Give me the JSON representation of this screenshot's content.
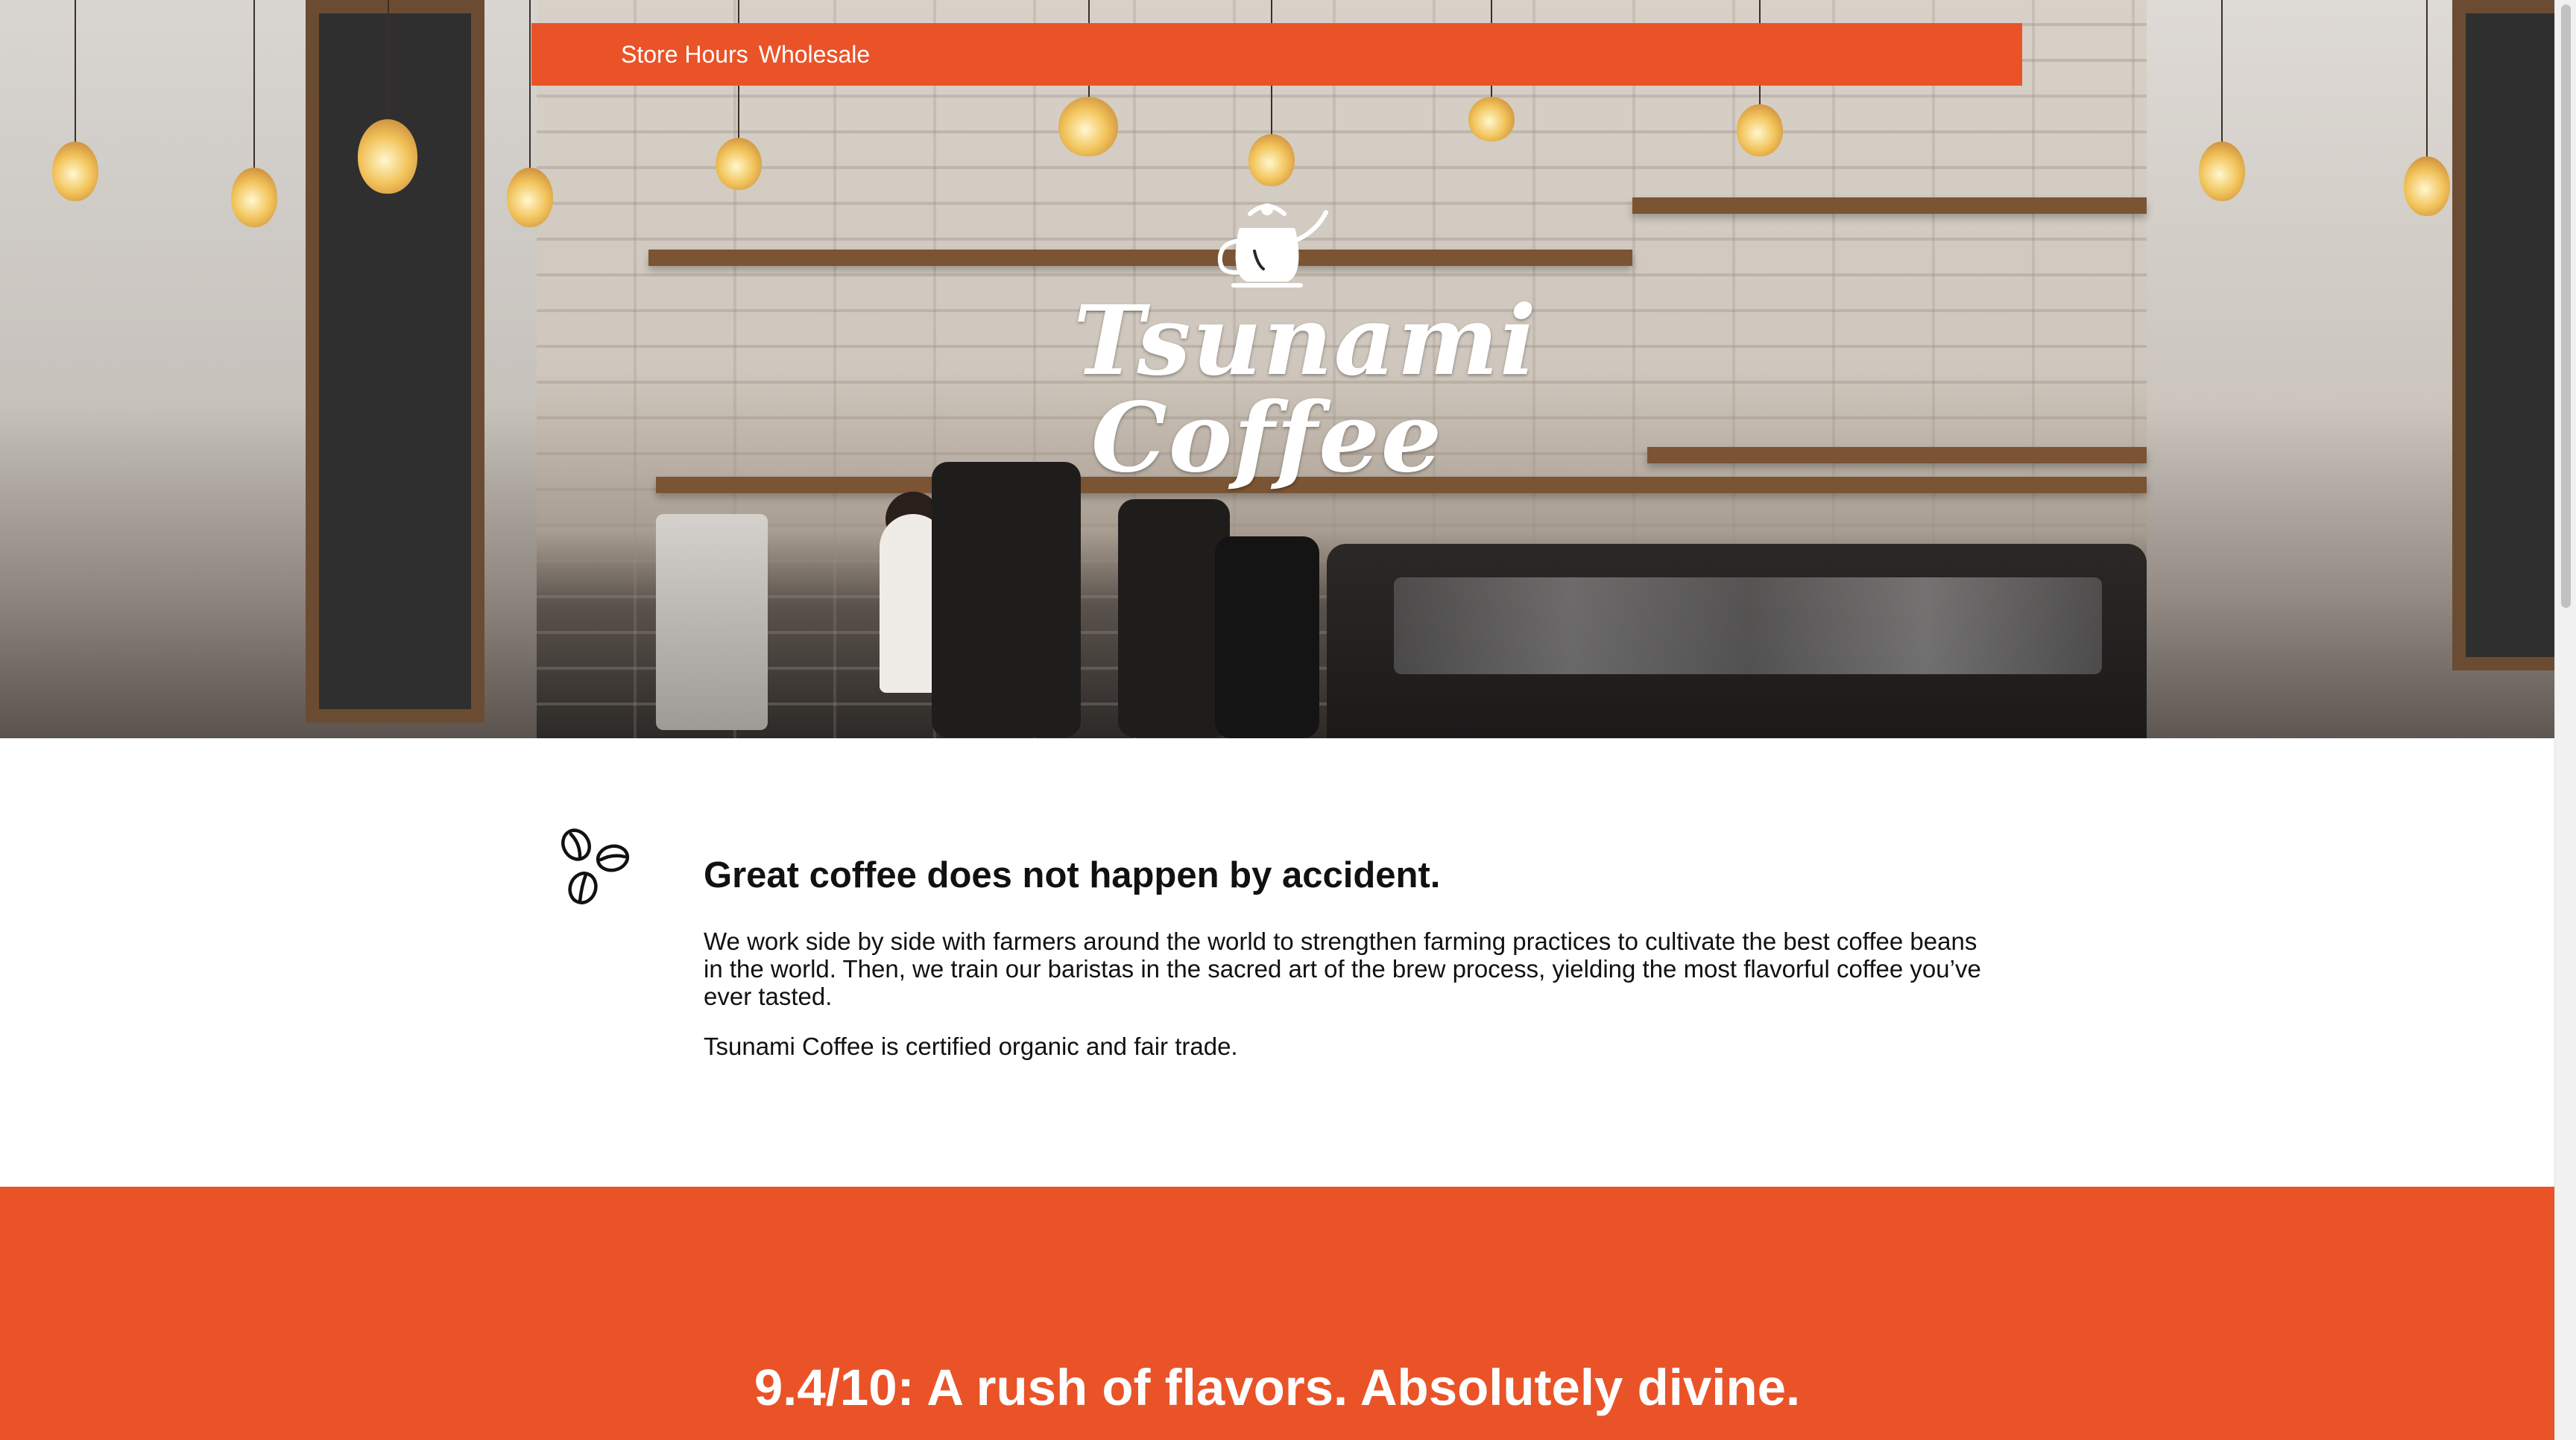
{
  "nav": {
    "links": [
      "Store Hours",
      "Wholesale"
    ]
  },
  "brand": {
    "name_line1": "Tsunami",
    "name_line2": "Coffee",
    "logo_icon": "kettle-icon"
  },
  "mission": {
    "icon": "coffee-beans-icon",
    "heading": "Great coffee does not happen by accident.",
    "paragraph1": "We work side by side with farmers around the world to strengthen farming practices to cultivate the best coffee beans in the world. Then, we train our baristas in the sacred art of the brew process, yielding the most flavorful coffee you’ve ever tasted.",
    "paragraph2": "Tsunami Coffee is certified organic and fair trade."
  },
  "review": {
    "quote": "9.4/10: A rush of flavors. Absolutely divine."
  },
  "colors": {
    "accent": "#ea5328",
    "text": "#111111",
    "background": "#ffffff"
  }
}
